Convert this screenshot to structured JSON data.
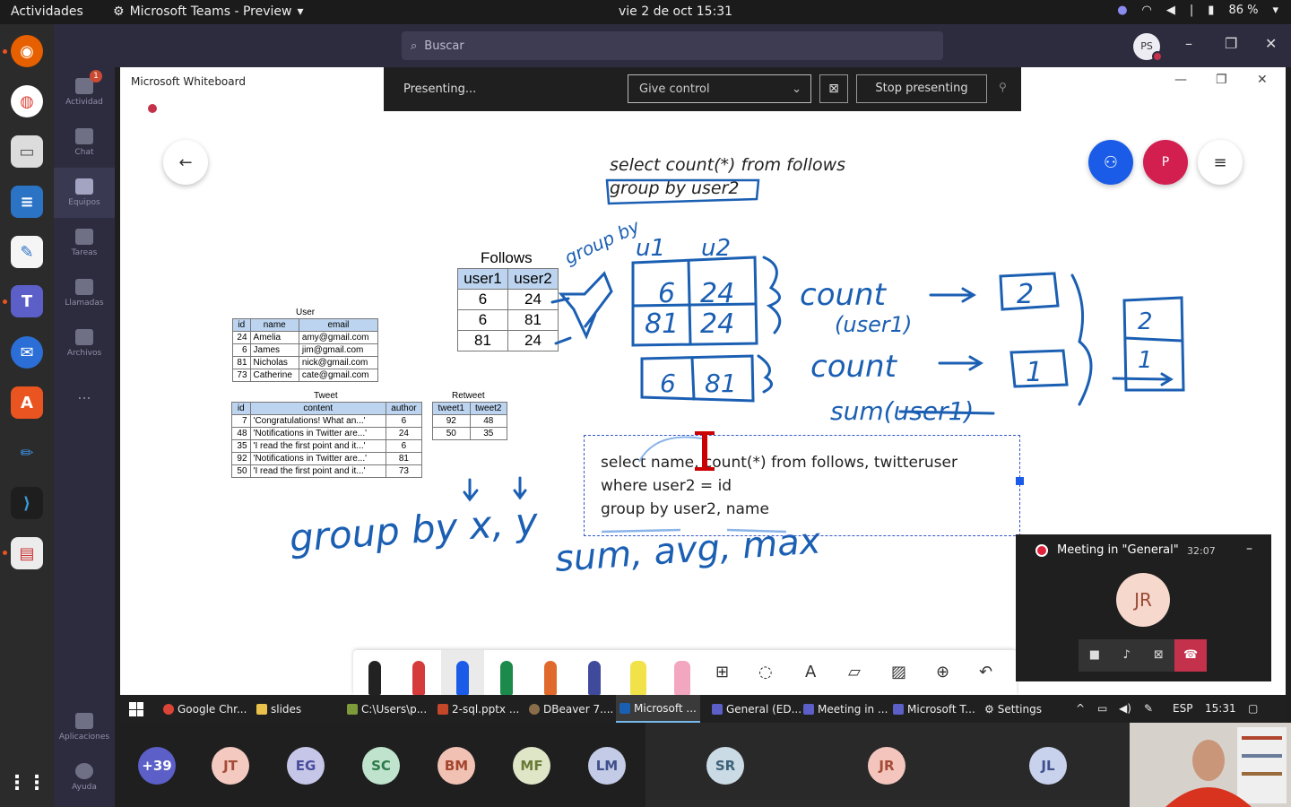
{
  "os_topbar": {
    "activities": "Actividades",
    "app_name": "Microsoft Teams - Preview",
    "datetime": "vie  2 de oct  15:31",
    "battery": "86 %"
  },
  "teams": {
    "search_placeholder": "Buscar",
    "profile_initials": "PS",
    "rail": [
      {
        "label": "Actividad",
        "badge": "1"
      },
      {
        "label": "Chat"
      },
      {
        "label": "Equipos"
      },
      {
        "label": "Tareas"
      },
      {
        "label": "Llamadas"
      },
      {
        "label": "Archivos"
      },
      {
        "label": "..."
      },
      {
        "label": "Aplicaciones"
      },
      {
        "label": "Ayuda"
      }
    ]
  },
  "whiteboard": {
    "title": "Microsoft Whiteboard",
    "share_initial": "P",
    "tables": {
      "follows": {
        "caption": "Follows",
        "headers": [
          "user1",
          "user2"
        ],
        "rows": [
          [
            "6",
            "24"
          ],
          [
            "6",
            "81"
          ],
          [
            "81",
            "24"
          ]
        ]
      },
      "user": {
        "caption": "User",
        "headers": [
          "id",
          "name",
          "email"
        ],
        "rows": [
          [
            "24",
            "Amelia",
            "amy@gmail.com"
          ],
          [
            "6",
            "James",
            "jim@gmail.com"
          ],
          [
            "81",
            "Nicholas",
            "nick@gmail.com"
          ],
          [
            "73",
            "Catherine",
            "cate@gmail.com"
          ]
        ]
      },
      "tweet": {
        "caption": "Tweet",
        "headers": [
          "id",
          "content",
          "author"
        ],
        "rows": [
          [
            "7",
            "'Congratulations! What an...'",
            "6"
          ],
          [
            "48",
            "'Notifications in Twitter are...'",
            "24"
          ],
          [
            "35",
            "'I read the first point and it...'",
            "6"
          ],
          [
            "92",
            "'Notifications in Twitter are...'",
            "81"
          ],
          [
            "50",
            "'I read the first point and it...'",
            "73"
          ]
        ]
      },
      "retweet": {
        "caption": "Retweet",
        "headers": [
          "tweet1",
          "tweet2"
        ],
        "rows": [
          [
            "92",
            "48"
          ],
          [
            "50",
            "35"
          ]
        ]
      }
    },
    "ink_text": {
      "query_line1": "select count(*) from follows",
      "query_line2": "group by user2",
      "group_by_label": "group by",
      "group_headers": [
        "u1",
        "u2"
      ],
      "group1_rows": [
        [
          "6",
          "24"
        ],
        [
          "81",
          "24"
        ]
      ],
      "group2_row": [
        "6",
        "81"
      ],
      "count1": "count",
      "count1_arg": "(user1)",
      "count2": "count",
      "result1": "2",
      "result2": "1",
      "final_results": [
        "2",
        "1"
      ],
      "sum_label": "sum(user1)",
      "bottom_group": "group by x, y",
      "aggregates": "sum, avg, max"
    },
    "textbox": {
      "line1": "select name, count(*) from follows, twitteruser",
      "line2": "where user2 = id",
      "line3": "group by user2, name"
    }
  },
  "presenting_bar": {
    "status": "Presenting...",
    "give_control": "Give control",
    "stop": "Stop presenting"
  },
  "meeting_window": {
    "title": "Meeting in \"General\"",
    "time": "32:07",
    "avatar": "JR"
  },
  "win_taskbar": {
    "items": [
      "Google Chr...",
      "slides",
      "C:\\Users\\p...",
      "2-sql.pptx ...",
      "DBeaver 7....",
      "Microsoft ...",
      "General (ED...",
      "Meeting in ...",
      "Microsoft T...",
      "Settings"
    ],
    "lang": "ESP",
    "clock": "15:31"
  },
  "participants": [
    {
      "initials": "+39",
      "color": "#5b5fc7"
    },
    {
      "initials": "JT",
      "color": "#f3c9c0"
    },
    {
      "initials": "EG",
      "color": "#c6c7e8"
    },
    {
      "initials": "SC",
      "color": "#bfe3cc"
    },
    {
      "initials": "BM",
      "color": "#f1c2b4"
    },
    {
      "initials": "MF",
      "color": "#dfe6c8"
    },
    {
      "initials": "LM",
      "color": "#c3cbe6"
    },
    {
      "initials": "SR",
      "color": "#cbdbe5"
    },
    {
      "initials": "JR",
      "color": "#f3c5bd"
    },
    {
      "initials": "JL",
      "color": "#c9d2ec"
    }
  ],
  "colors": {
    "ink_blue": "#1b5fb3",
    "teams_rail": "#2d2c3f",
    "accent_red": "#c4314b"
  }
}
